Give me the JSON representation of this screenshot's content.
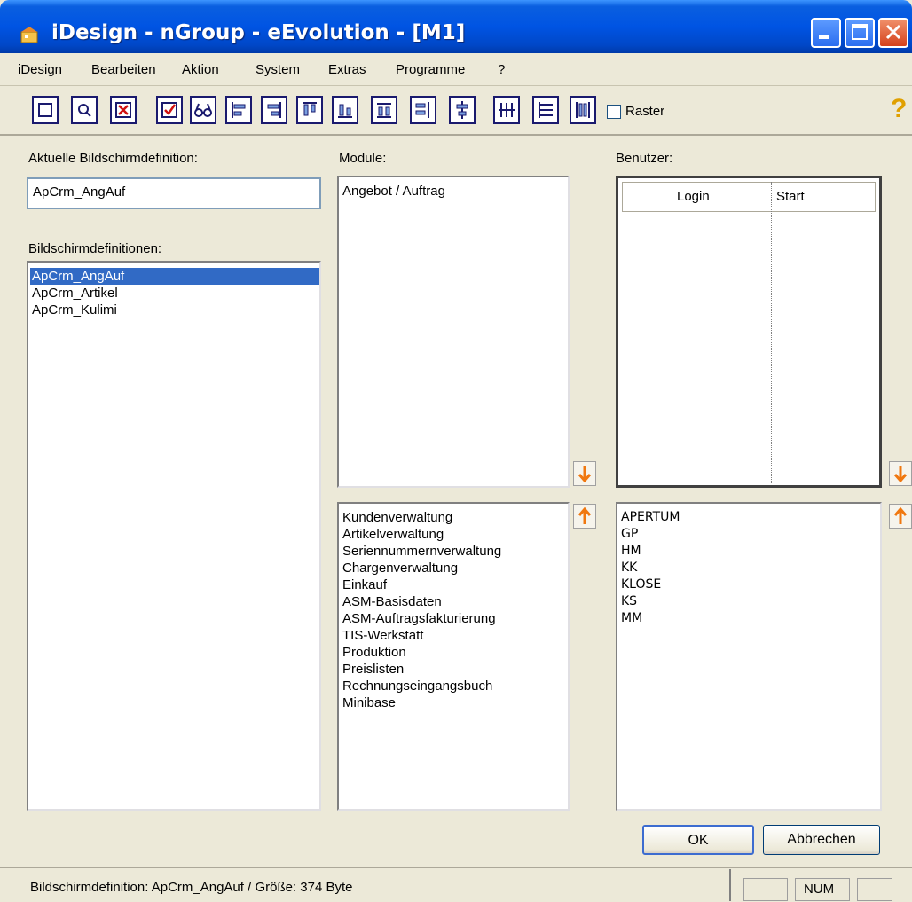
{
  "window": {
    "title": "iDesign  -  nGroup  -  eEvolution  -  [M1]"
  },
  "menu": [
    "iDesign",
    "Bearbeiten",
    "Aktion",
    "System",
    "Extras",
    "Programme",
    "?"
  ],
  "toolbar": {
    "icons": [
      "new-icon",
      "preview-icon",
      "delete-icon",
      "check-icon",
      "glasses-icon",
      "align-left-icon",
      "align-right-icon",
      "align-top-icon",
      "align-bottom-icon",
      "spacing-icon",
      "distribute-horizontal-icon",
      "center-icon",
      "grid-columns-icon",
      "grid-rows-icon",
      "distribute-vertical-icon"
    ],
    "raster_label": "Raster",
    "raster_checked": false
  },
  "left": {
    "current_label": "Aktuelle Bildschirmdefinition:",
    "current_value": "ApCrm_AngAuf",
    "list_label": "Bildschirmdefinitionen:",
    "items": [
      "ApCrm_AngAuf",
      "ApCrm_Artikel",
      "ApCrm_Kulimi"
    ],
    "selected": 0
  },
  "modules": {
    "label": "Module:",
    "assigned": [
      "Angebot / Auftrag"
    ],
    "available": [
      "Kundenverwaltung",
      "Artikelverwaltung",
      "Seriennummernverwaltung",
      "Chargenverwaltung",
      "Einkauf",
      "ASM-Basisdaten",
      "ASM-Auftragsfakturierung",
      "TIS-Werkstatt",
      "Produktion",
      "Preislisten",
      "Rechnungseingangsbuch",
      "Minibase"
    ]
  },
  "users": {
    "label": "Benutzer:",
    "columns": [
      "Login",
      "Start"
    ],
    "available": [
      "APERTUM",
      "GP",
      "HM",
      "KK",
      "KLOSE",
      "KS",
      "MM"
    ]
  },
  "buttons": {
    "ok": "OK",
    "cancel": "Abbrechen"
  },
  "status": {
    "text": "Bildschirmdefinition: ApCrm_AngAuf / Größe: 374 Byte",
    "num": "NUM"
  }
}
